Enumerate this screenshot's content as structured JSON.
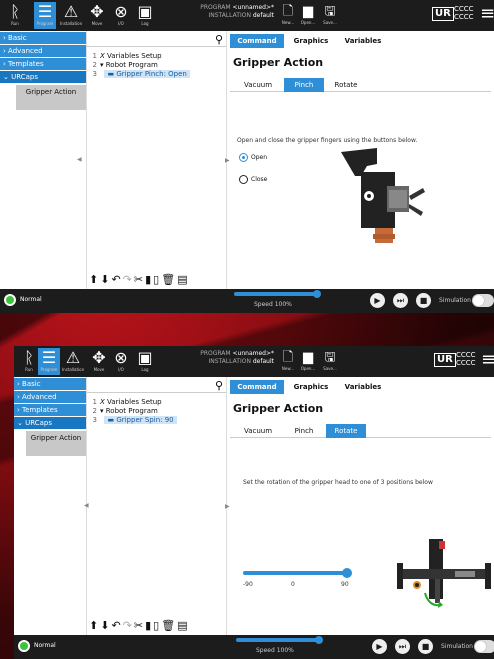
{
  "screens": [
    {
      "header": {
        "nav": [
          {
            "label": "Run"
          },
          {
            "label": "Program"
          },
          {
            "label": "Installation"
          },
          {
            "label": "Move"
          },
          {
            "label": "I/O"
          },
          {
            "label": "Log"
          }
        ],
        "program_label": "PROGRAM",
        "program_value": "<unnamed>*",
        "installation_label": "INSTALLATION",
        "installation_value": "default",
        "file_buttons": [
          {
            "label": "New..."
          },
          {
            "label": "Open..."
          },
          {
            "label": "Save..."
          }
        ],
        "logo_text": "UR",
        "cccc_line1": "CCCC",
        "cccc_line2": "CCCC"
      },
      "sidebar": {
        "items": [
          {
            "label": "Basic"
          },
          {
            "label": "Advanced"
          },
          {
            "label": "Templates"
          },
          {
            "label": "URCaps"
          }
        ],
        "sub_item": "Gripper Action"
      },
      "tree": {
        "rows": [
          {
            "num": "1",
            "text": "Variables Setup"
          },
          {
            "num": "2",
            "text": "Robot Program"
          },
          {
            "num": "3",
            "text": "Gripper Pinch: Open"
          }
        ]
      },
      "content": {
        "tabs": [
          {
            "label": "Command"
          },
          {
            "label": "Graphics"
          },
          {
            "label": "Variables"
          }
        ],
        "title": "Gripper Action",
        "inner_tabs": [
          {
            "label": "Vacuum"
          },
          {
            "label": "Pinch"
          },
          {
            "label": "Rotate"
          }
        ],
        "instruction": "Open and close the gripper fingers using the buttons below.",
        "radio_open": "Open",
        "radio_close": "Close"
      },
      "footer": {
        "status": "Normal",
        "speed": "Speed 100%",
        "simulation": "Simulation"
      }
    },
    {
      "header": {
        "nav": [
          {
            "label": "Run"
          },
          {
            "label": "Program"
          },
          {
            "label": "Installation"
          },
          {
            "label": "Move"
          },
          {
            "label": "I/O"
          },
          {
            "label": "Log"
          }
        ],
        "program_label": "PROGRAM",
        "program_value": "<unnamed>*",
        "installation_label": "INSTALLATION",
        "installation_value": "default",
        "file_buttons": [
          {
            "label": "New..."
          },
          {
            "label": "Open..."
          },
          {
            "label": "Save..."
          }
        ],
        "logo_text": "UR",
        "cccc_line1": "CCCC",
        "cccc_line2": "CCCC"
      },
      "sidebar": {
        "items": [
          {
            "label": "Basic"
          },
          {
            "label": "Advanced"
          },
          {
            "label": "Templates"
          },
          {
            "label": "URCaps"
          }
        ],
        "sub_item": "Gripper Action"
      },
      "tree": {
        "rows": [
          {
            "num": "1",
            "text": "Variables Setup"
          },
          {
            "num": "2",
            "text": "Robot Program"
          },
          {
            "num": "3",
            "text": "Gripper Spin: 90"
          }
        ]
      },
      "content": {
        "tabs": [
          {
            "label": "Command"
          },
          {
            "label": "Graphics"
          },
          {
            "label": "Variables"
          }
        ],
        "title": "Gripper Action",
        "inner_tabs": [
          {
            "label": "Vacuum"
          },
          {
            "label": "Pinch"
          },
          {
            "label": "Rotate"
          }
        ],
        "instruction": "Set the rotation of the gripper head to one of 3 positions below",
        "slider_labels": [
          "-90",
          "0",
          "90"
        ],
        "slider_value": 90
      },
      "footer": {
        "status": "Normal",
        "speed": "Speed 100%",
        "simulation": "Simulation"
      }
    }
  ]
}
